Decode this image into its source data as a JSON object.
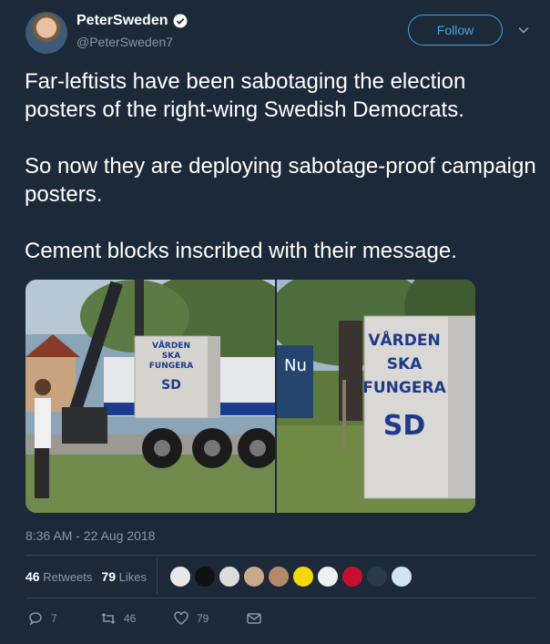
{
  "user": {
    "display_name": "PeterSweden",
    "handle": "@PeterSweden7",
    "follow_label": "Follow"
  },
  "tweet": {
    "text": "Far-leftists have been sabotaging the election posters of the right-wing Swedish Democrats.\n\nSo now they are deploying sabotage-proof campaign posters.\n\nCement blocks inscribed with their message.",
    "timestamp": "8:36 AM - 22 Aug 2018"
  },
  "images": {
    "left_block_lines": [
      "VÅRDEN",
      "SKA",
      "FUNGERA",
      "SD"
    ],
    "right_block_lines": [
      "VÅRDEN",
      "SKA",
      "FUNGERA",
      "SD"
    ],
    "poster_text": "Nu"
  },
  "stats": {
    "retweets_count": "46",
    "retweets_label": "Retweets",
    "likes_count": "79",
    "likes_label": "Likes"
  },
  "actions": {
    "reply_count": "7",
    "retweet_count": "46",
    "like_count": "79"
  },
  "colors": {
    "background": "#1c2938",
    "accent": "#4aa3df",
    "muted": "#8899a6",
    "block_text": "#1f3a8a"
  },
  "icons": [
    "verified-icon",
    "chevron-down-icon",
    "reply-icon",
    "retweet-icon",
    "like-icon",
    "message-icon"
  ]
}
